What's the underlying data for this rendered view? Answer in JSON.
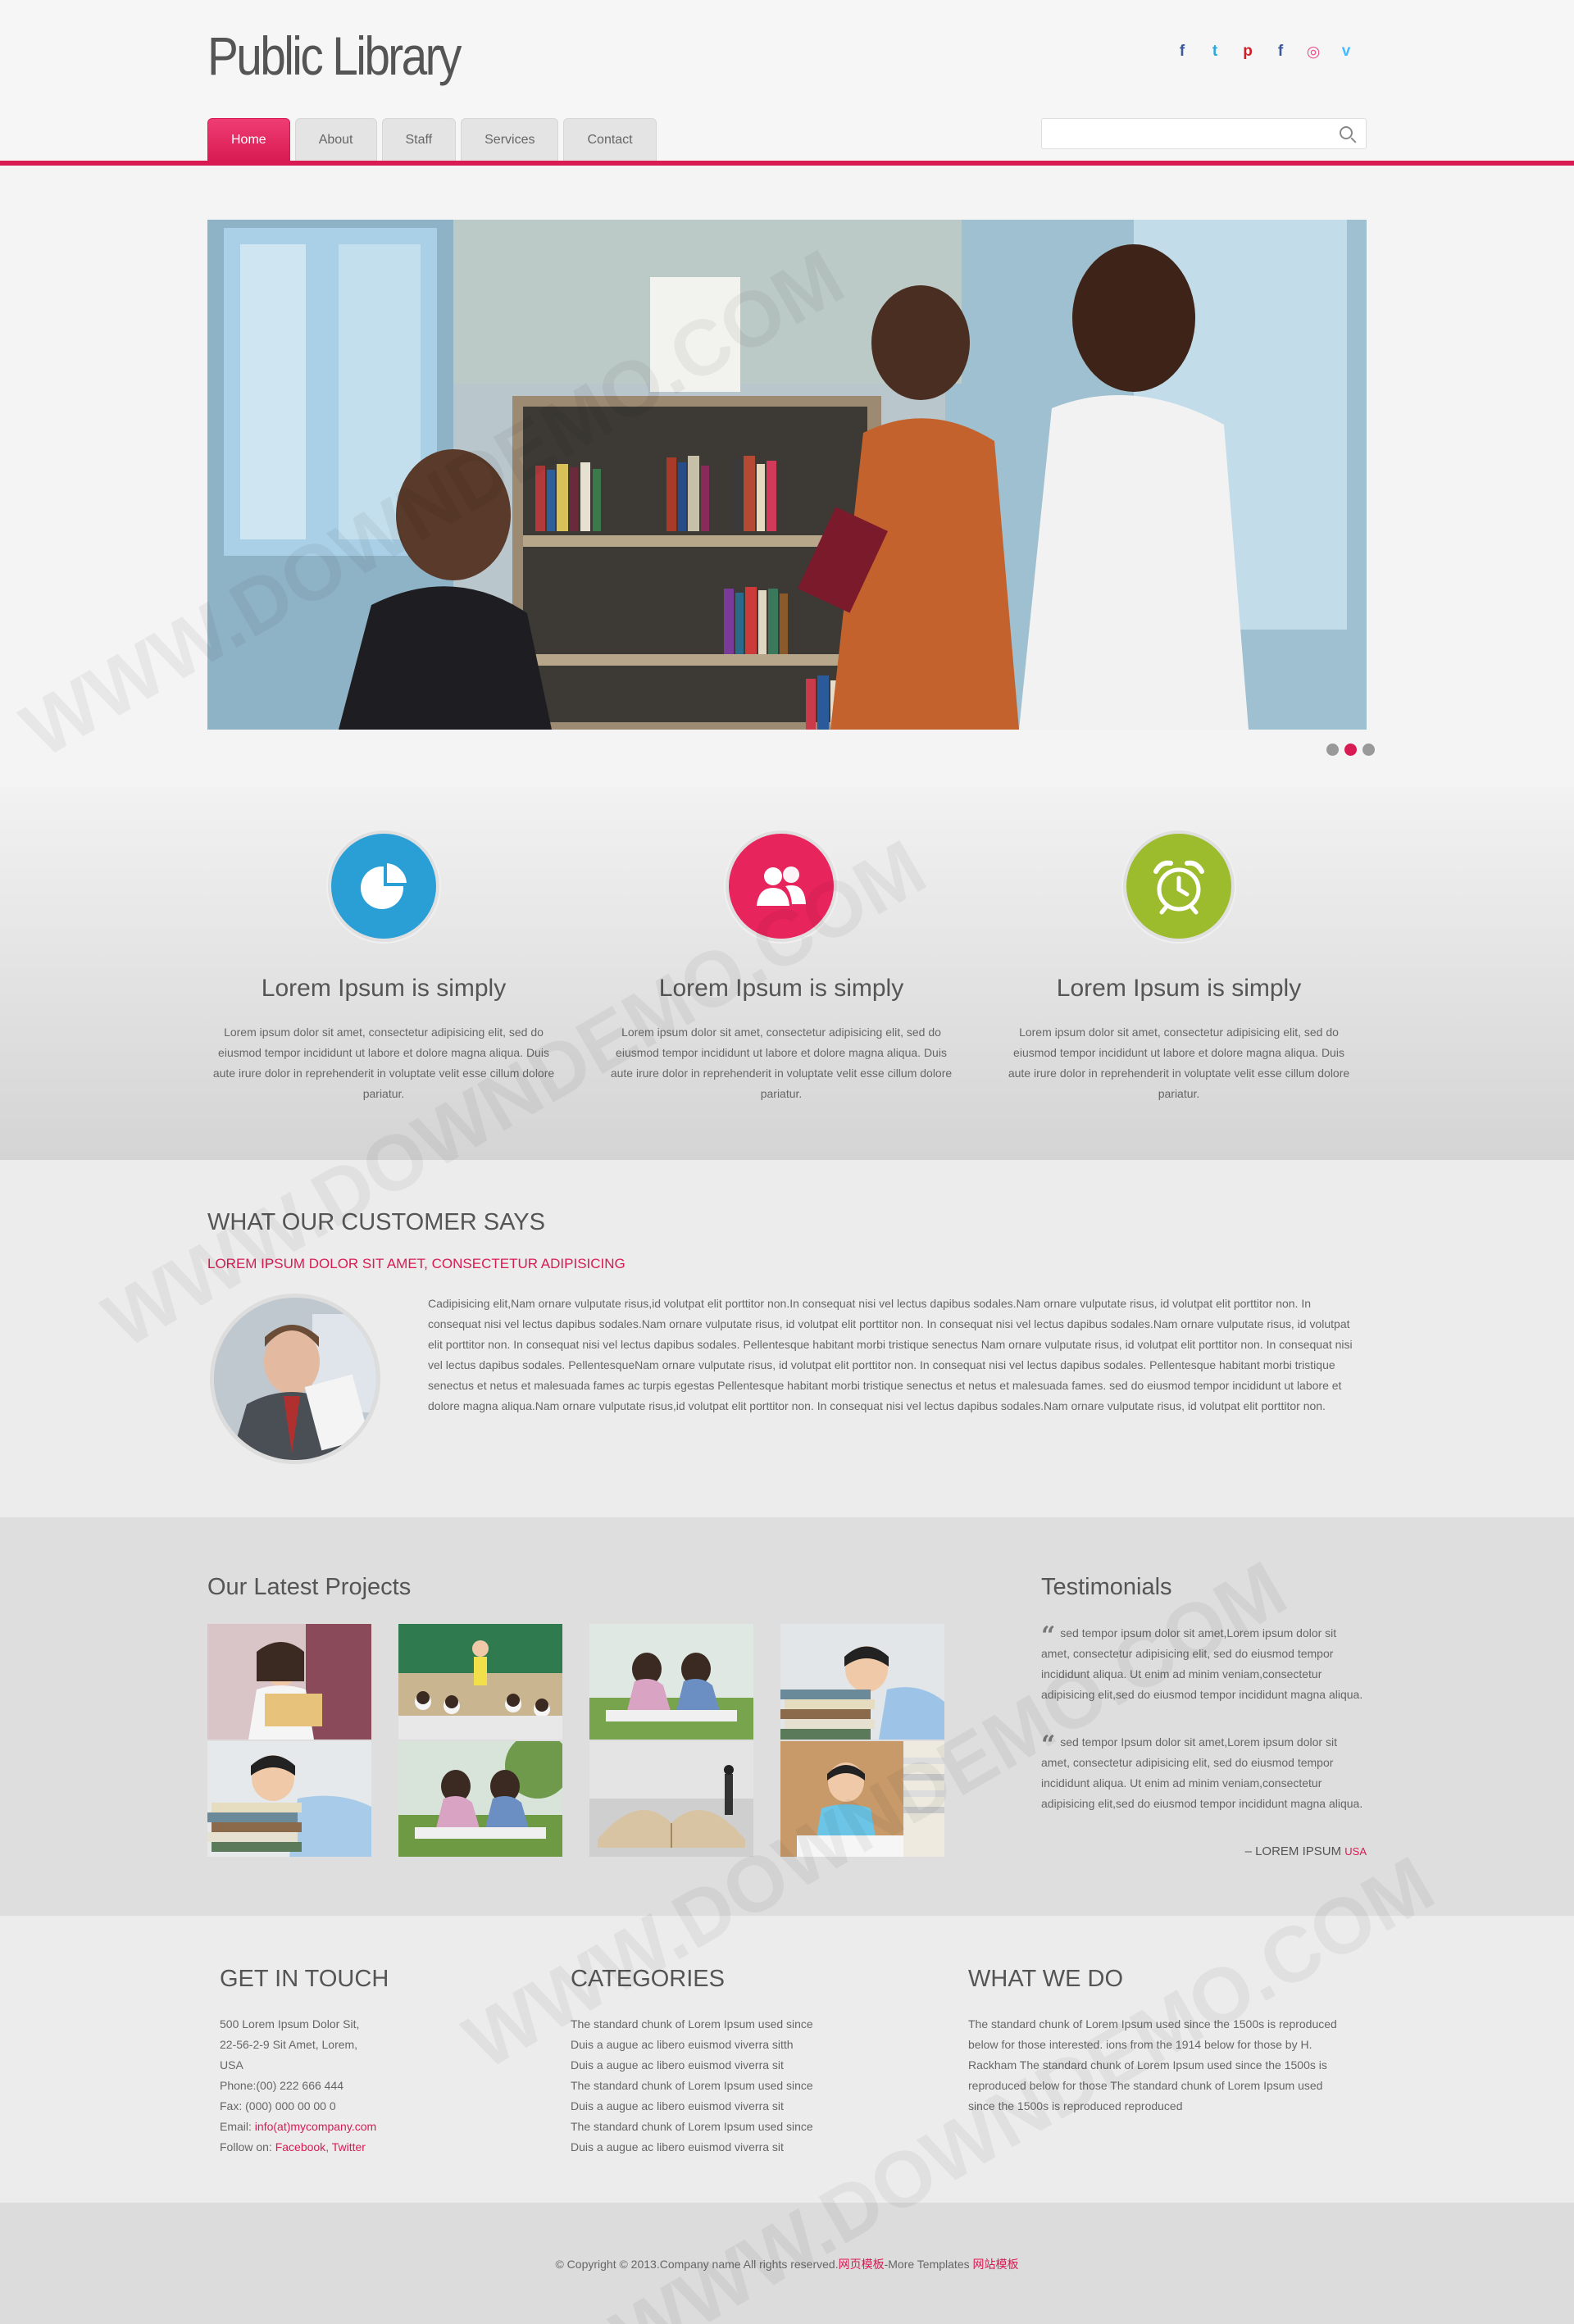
{
  "header": {
    "logo": "Public Library",
    "social": [
      {
        "icon": "facebook-icon",
        "glyph": "f",
        "color": "#3b5998"
      },
      {
        "icon": "twitter-icon",
        "glyph": "t",
        "color": "#2aa9e0"
      },
      {
        "icon": "pinterest-icon",
        "glyph": "p",
        "color": "#cb2027"
      },
      {
        "icon": "facebook-icon",
        "glyph": "f",
        "color": "#3b5998"
      },
      {
        "icon": "dribbble-icon",
        "glyph": "◎",
        "color": "#ea4c89"
      },
      {
        "icon": "vimeo-icon",
        "glyph": "v",
        "color": "#44bbff"
      }
    ]
  },
  "nav": {
    "home": "Home",
    "about": "About",
    "staff": "Staff",
    "services": "Services",
    "contact": "Contact"
  },
  "search": {
    "placeholder": ""
  },
  "slider": {
    "active_dot": 2,
    "dot_count": 3
  },
  "features": [
    {
      "icon": "pie-chart-icon",
      "color": "#2a9fd6",
      "title": "Lorem Ipsum is simply",
      "text": "Lorem ipsum dolor sit amet, consectetur adipisicing elit, sed do eiusmod tempor incididunt ut labore et dolore magna aliqua. Duis aute irure dolor in reprehenderit in voluptate velit esse cillum dolore pariatur."
    },
    {
      "icon": "users-icon",
      "color": "#e8245c",
      "title": "Lorem Ipsum is simply",
      "text": "Lorem ipsum dolor sit amet, consectetur adipisicing elit, sed do eiusmod tempor incididunt ut labore et dolore magna aliqua. Duis aute irure dolor in reprehenderit in voluptate velit esse cillum dolore pariatur."
    },
    {
      "icon": "alarm-clock-icon",
      "color": "#9cbc2d",
      "title": "Lorem Ipsum is simply",
      "text": "Lorem ipsum dolor sit amet, consectetur adipisicing elit, sed do eiusmod tempor incididunt ut labore et dolore magna aliqua. Duis aute irure dolor in reprehenderit in voluptate velit esse cillum dolore pariatur."
    }
  ],
  "customer": {
    "title": "WHAT OUR CUSTOMER SAYS",
    "subtitle": "LOREM IPSUM DOLOR SIT AMET, CONSECTETUR ADIPISICING",
    "text": "Cadipisicing elit,Nam ornare vulputate risus,id volutpat elit porttitor non.In consequat nisi vel lectus dapibus sodales.Nam ornare vulputate risus, id volutpat elit porttitor non. In consequat nisi vel lectus dapibus sodales.Nam ornare vulputate risus, id volutpat elit porttitor non. In consequat nisi vel lectus dapibus sodales.Nam ornare vulputate risus, id volutpat elit porttitor non. In consequat nisi vel lectus dapibus sodales. Pellentesque habitant morbi tristique senectus Nam ornare vulputate risus, id volutpat elit porttitor non. In consequat nisi vel lectus dapibus sodales. PellentesqueNam ornare vulputate risus, id volutpat elit porttitor non. In consequat nisi vel lectus dapibus sodales. Pellentesque habitant morbi tristique senectus et netus et malesuada fames ac turpis egestas Pellentesque habitant morbi tristique senectus et netus et malesuada fames. sed do eiusmod tempor incididunt ut labore et dolore magna aliqua.Nam ornare vulputate risus,id volutpat elit porttitor non. In consequat nisi vel lectus dapibus sodales.Nam ornare vulputate risus, id volutpat elit porttitor non."
  },
  "projects": {
    "title": "Our Latest Projects"
  },
  "testimonials": {
    "title": "Testimonials",
    "quotes": [
      "sed tempor ipsum dolor sit amet,Lorem ipsum dolor sit amet, consectetur adipisicing elit, sed do eiusmod tempor incididunt aliqua. Ut enim ad minim veniam,consectetur adipisicing elit,sed do eiusmod tempor incididunt magna aliqua.",
      "sed tempor Ipsum dolor sit amet,Lorem ipsum dolor sit amet, consectetur adipisicing elit, sed do eiusmod tempor incididunt aliqua. Ut enim ad minim veniam,consectetur adipisicing elit,sed do eiusmod tempor incididunt magna aliqua."
    ],
    "sign_name": "– LOREM IPSUM",
    "sign_place": "USA"
  },
  "footer": {
    "touch_title": "GET IN TOUCH",
    "address1": "500 Lorem Ipsum Dolor Sit,",
    "address2": "22-56-2-9 Sit Amet, Lorem,",
    "address3": "USA",
    "phone": "Phone:(00) 222 666 444",
    "fax": "Fax: (000) 000 00 00 0",
    "email_label": "Email: ",
    "email": "info(at)mycompany.com",
    "follow_label": "Follow on: ",
    "facebook": "Facebook",
    "sep": ", ",
    "twitter": "Twitter",
    "categories_title": "CATEGORIES",
    "categories": [
      "The standard chunk of Lorem Ipsum used since",
      "Duis a augue ac libero euismod viverra sitth",
      "Duis a augue ac libero euismod viverra sit",
      "The standard chunk of Lorem Ipsum used since",
      "Duis a augue ac libero euismod viverra sit",
      "The standard chunk of Lorem Ipsum used since",
      "Duis a augue ac libero euismod viverra sit"
    ],
    "whatwedo_title": "WHAT WE DO",
    "whatwedo": "The standard chunk of Lorem Ipsum used since the 1500s is reproduced below for those interested. ions from the 1914 below for those by H. Rackham The standard chunk of Lorem Ipsum used since the 1500s is reproduced below for those The standard chunk of Lorem Ipsum used since the 1500s is reproduced reproduced"
  },
  "copyright": {
    "text": "© Copyright © 2013.Company name All rights reserved.",
    "link1": "网页模板",
    "middle": "-More Templates ",
    "link2": "网站模板"
  },
  "watermark": "WWW.DOWNDEMO.COM"
}
